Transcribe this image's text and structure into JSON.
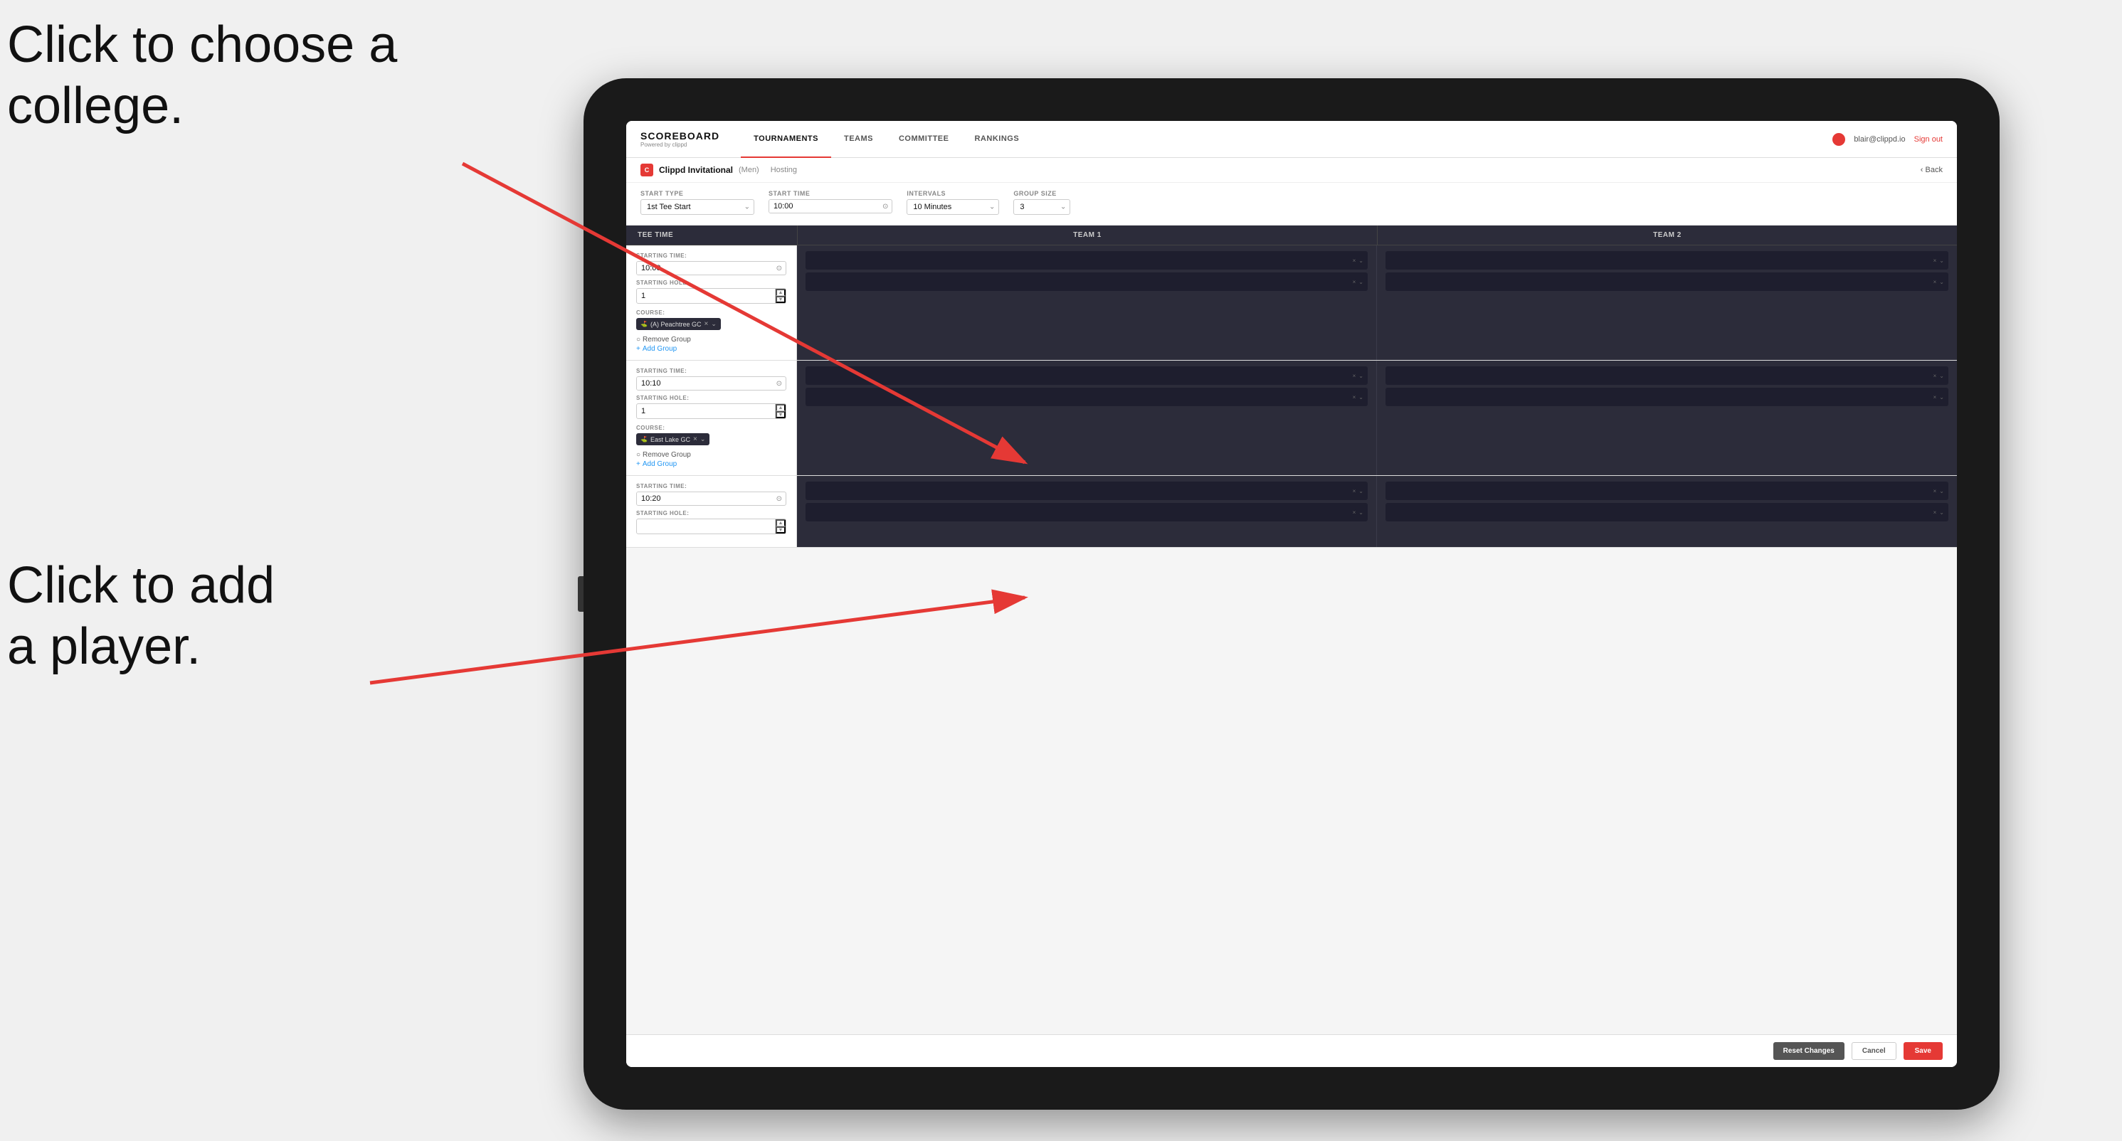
{
  "annotations": {
    "top": "Click to choose a\ncollege.",
    "bottom": "Click to add\na player."
  },
  "nav": {
    "logo": "SCOREBOARD",
    "logo_sub": "Powered by clippd",
    "items": [
      "TOURNAMENTS",
      "TEAMS",
      "COMMITTEE",
      "RANKINGS"
    ],
    "active_item": "TOURNAMENTS",
    "user_email": "blair@clippd.io",
    "sign_out": "Sign out"
  },
  "sub_header": {
    "tournament": "Clippd Invitational",
    "gender": "(Men)",
    "hosting": "Hosting",
    "back": "Back"
  },
  "form": {
    "start_type_label": "Start Type",
    "start_type_value": "1st Tee Start",
    "start_time_label": "Start Time",
    "start_time_value": "10:00",
    "intervals_label": "Intervals",
    "intervals_value": "10 Minutes",
    "group_size_label": "Group Size",
    "group_size_value": "3"
  },
  "table": {
    "col1": "Tee Time",
    "col2": "Team 1",
    "col3": "Team 2"
  },
  "rows": [
    {
      "starting_time": "10:00",
      "starting_hole": "1",
      "course": "(A) Peachtree GC",
      "course_icon": "🏌",
      "team1_slots": 2,
      "team2_slots": 2
    },
    {
      "starting_time": "10:10",
      "starting_hole": "1",
      "course": "East Lake GC",
      "course_icon": "🏌",
      "team1_slots": 2,
      "team2_slots": 2
    },
    {
      "starting_time": "10:20",
      "starting_hole": "",
      "course": "",
      "team1_slots": 2,
      "team2_slots": 2
    }
  ],
  "buttons": {
    "reset": "Reset Changes",
    "cancel": "Cancel",
    "save": "Save"
  },
  "labels": {
    "starting_time": "STARTING TIME:",
    "starting_hole": "STARTING HOLE:",
    "course": "COURSE:",
    "remove_group": "Remove Group",
    "add_group": "Add Group"
  }
}
